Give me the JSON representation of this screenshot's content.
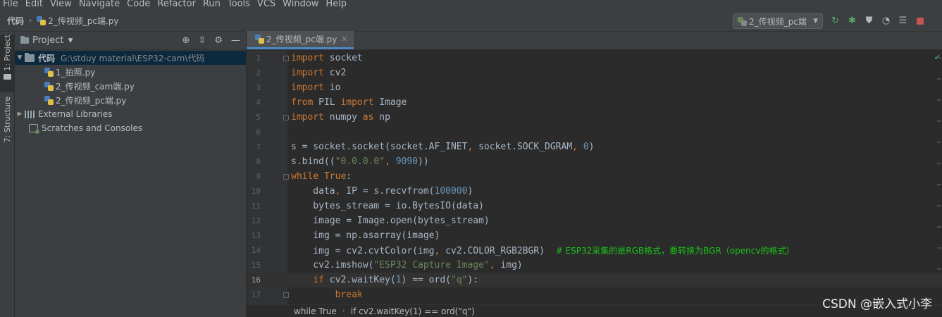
{
  "menu": [
    "File",
    "Edit",
    "View",
    "Navigate",
    "Code",
    "Refactor",
    "Run",
    "Tools",
    "VCS",
    "Window",
    "Help"
  ],
  "breadcrumb": {
    "root": "代码",
    "file": "2_传视频_pc端.py"
  },
  "run_config": {
    "label": "2_传视频_pc端"
  },
  "toolbar_icons": [
    "rerun-icon",
    "debug-icon",
    "coverage-icon",
    "profile-icon",
    "run-list-icon",
    "stop-icon"
  ],
  "sidebar_tabs": {
    "project": "1: Project",
    "structure": "7: Structure"
  },
  "project_panel": {
    "title": "Project",
    "root": {
      "name": "代码",
      "path": "G:\\stduy material\\ESP32-cam\\代码"
    },
    "files": [
      "1_拍照.py",
      "2_传视频_cam端.py",
      "2_传视频_pc端.py"
    ],
    "external_libraries": "External Libraries",
    "scratches": "Scratches and Consoles"
  },
  "editor": {
    "tab_label": "2_传视频_pc端.py",
    "current_line": 16,
    "lines": [
      [
        [
          "kw",
          "import"
        ],
        [
          "t",
          " socket"
        ]
      ],
      [
        [
          "kw",
          "import"
        ],
        [
          "t",
          " cv2"
        ]
      ],
      [
        [
          "kw",
          "import"
        ],
        [
          "t",
          " io"
        ]
      ],
      [
        [
          "kw",
          "from"
        ],
        [
          "t",
          " PIL "
        ],
        [
          "kw",
          "import"
        ],
        [
          "t",
          " Image"
        ]
      ],
      [
        [
          "kw",
          "import"
        ],
        [
          "t",
          " numpy "
        ],
        [
          "kw",
          "as"
        ],
        [
          "t",
          " np"
        ]
      ],
      [],
      [
        [
          "t",
          "s = socket.socket(socket.AF_INET"
        ],
        [
          "kw",
          ","
        ],
        [
          "t",
          " socket.SOCK_DGRAM"
        ],
        [
          "kw",
          ","
        ],
        [
          "t",
          " "
        ],
        [
          "num",
          "0"
        ],
        [
          "t",
          ")"
        ]
      ],
      [
        [
          "t",
          "s.bind(("
        ],
        [
          "str",
          "\"0.0.0.0\""
        ],
        [
          "kw",
          ","
        ],
        [
          "t",
          " "
        ],
        [
          "num",
          "9090"
        ],
        [
          "t",
          "))"
        ]
      ],
      [
        [
          "kw",
          "while"
        ],
        [
          "t",
          " "
        ],
        [
          "kw",
          "True"
        ],
        [
          "t",
          ":"
        ]
      ],
      [
        [
          "t",
          "    data"
        ],
        [
          "kw",
          ","
        ],
        [
          "t",
          " IP = s.recvfrom("
        ],
        [
          "num",
          "100000"
        ],
        [
          "t",
          ")"
        ]
      ],
      [
        [
          "t",
          "    bytes_stream = io.BytesIO(data)"
        ]
      ],
      [
        [
          "t",
          "    image = Image.open(bytes_stream)"
        ]
      ],
      [
        [
          "t",
          "    img = np.asarray(image)"
        ]
      ],
      [
        [
          "t",
          "    img = cv2.cvtColor(img"
        ],
        [
          "kw",
          ","
        ],
        [
          "t",
          " cv2.COLOR_RGB2BGR)  "
        ],
        [
          "cm",
          "# ESP32采集的是RGB格式，要转换为BGR（opencv的格式）"
        ]
      ],
      [
        [
          "t",
          "    cv2.imshow("
        ],
        [
          "str",
          "\"ESP32 Capture Image\""
        ],
        [
          "kw",
          ","
        ],
        [
          "t",
          " img)"
        ]
      ],
      [
        [
          "t",
          "    "
        ],
        [
          "kw",
          "if"
        ],
        [
          "t",
          " cv2.waitKey("
        ],
        [
          "num",
          "1"
        ],
        [
          "t",
          ") == ord("
        ],
        [
          "str",
          "\"q\""
        ],
        [
          "t",
          "):"
        ]
      ],
      [
        [
          "t",
          "        "
        ],
        [
          "kw",
          "break"
        ]
      ]
    ]
  },
  "status_breadcrumb": [
    "while True",
    "if cv2.waitKey(1) == ord(\"q\")"
  ],
  "watermark": "CSDN @嵌入式小李"
}
